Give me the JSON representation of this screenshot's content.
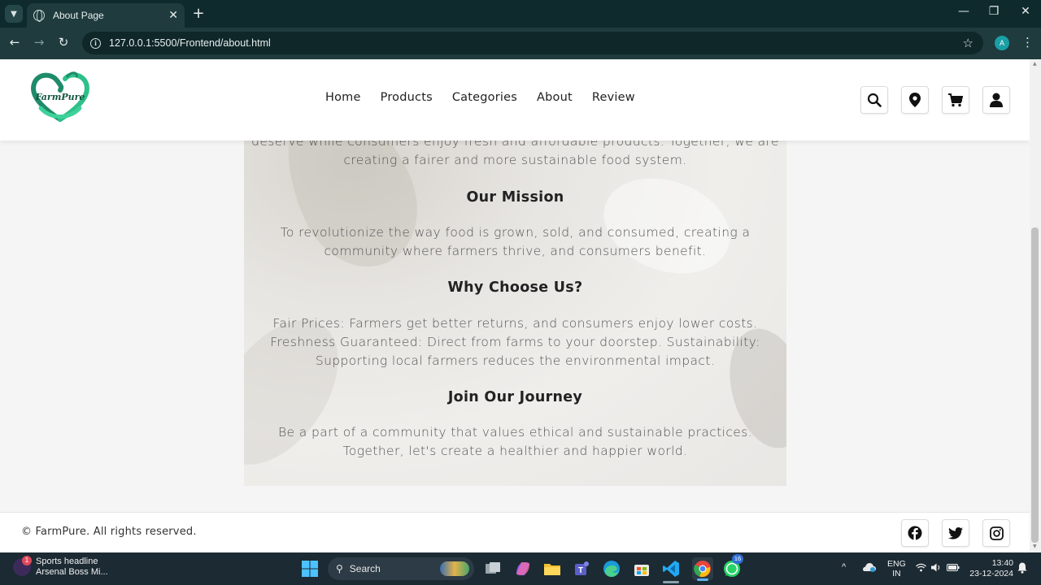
{
  "browser": {
    "tab_title": "About Page",
    "url": "127.0.0.1:5500/Frontend/about.html",
    "profile_initial": "A"
  },
  "header": {
    "logo_text": "FarmPure",
    "nav": [
      "Home",
      "Products",
      "Categories",
      "About",
      "Review"
    ],
    "icons": [
      "search-icon",
      "location-pin-icon",
      "cart-icon",
      "user-icon"
    ]
  },
  "content": {
    "intro_tail_1": "deserve while consumers enjoy fresh and affordable products. Together, we are",
    "intro_tail_2": "creating a fairer and more sustainable food system.",
    "mission_heading": "Our Mission",
    "mission_1": "To revolutionize the way food is grown, sold, and consumed, creating a",
    "mission_2": "community where farmers thrive, and consumers benefit.",
    "why_heading": "Why Choose Us?",
    "why_1": "Fair Prices: Farmers get better returns, and consumers enjoy lower costs.",
    "why_2": "Freshness Guaranteed: Direct from farms to your doorstep. Sustainability:",
    "why_3": "Supporting local farmers reduces the environmental impact.",
    "join_heading": "Join Our Journey",
    "join_1": "Be a part of a community that values ethical and sustainable practices.",
    "join_2": "Together, let's create a healthier and happier world."
  },
  "footer": {
    "copyright": "© FarmPure. All rights reserved.",
    "social": [
      "facebook-icon",
      "twitter-icon",
      "instagram-icon"
    ]
  },
  "taskbar": {
    "news_badge": "1",
    "news_title": "Sports headline",
    "news_sub": "Arsenal Boss Mi...",
    "search_label": "Search",
    "whatsapp_badge": "16",
    "lang_1": "ENG",
    "lang_2": "IN",
    "time": "13:40",
    "date": "23-12-2024"
  },
  "colors": {
    "chrome_dark": "#0e2a2c",
    "chrome_bar": "#1f3b3d",
    "logo_green": "#1e8b6a",
    "taskbar": "#1c2a33"
  }
}
